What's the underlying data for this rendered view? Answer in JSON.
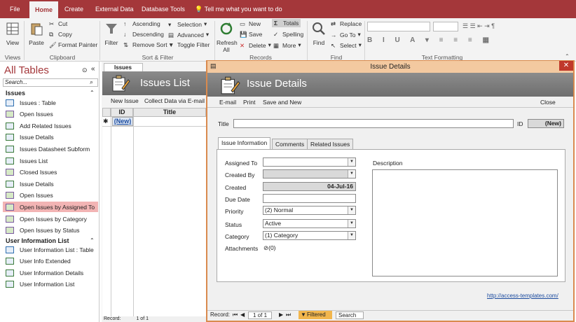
{
  "ribbon_tabs": [
    "File",
    "Home",
    "Create",
    "External Data",
    "Database Tools"
  ],
  "tell_me": "Tell me what you want to do",
  "groups": {
    "views": {
      "label": "Views",
      "view": "View"
    },
    "clipboard": {
      "label": "Clipboard",
      "paste": "Paste",
      "cut": "Cut",
      "copy": "Copy",
      "format_painter": "Format Painter"
    },
    "sort_filter": {
      "label": "Sort & Filter",
      "filter": "Filter",
      "ascending": "Ascending",
      "descending": "Descending",
      "remove_sort": "Remove Sort",
      "selection": "Selection",
      "advanced": "Advanced",
      "toggle_filter": "Toggle Filter"
    },
    "records": {
      "label": "Records",
      "refresh": "Refresh",
      "all": "All",
      "new": "New",
      "save": "Save",
      "delete": "Delete",
      "totals": "Totals",
      "spelling": "Spelling",
      "more": "More"
    },
    "find": {
      "label": "Find",
      "find": "Find",
      "replace": "Replace",
      "go_to": "Go To",
      "select": "Select"
    },
    "text_formatting": {
      "label": "Text Formatting"
    }
  },
  "nav": {
    "title": "All Tables",
    "search_placeholder": "Search...",
    "groups": [
      {
        "name": "Issues",
        "items": [
          "Issues : Table",
          "Open Issues",
          "Add Related Issues",
          "Issue Details",
          "Issues Datasheet Subform",
          "Issues List",
          "Closed Issues",
          "Issue Details",
          "Open Issues",
          "Open Issues by Assigned To",
          "Open Issues by Category",
          "Open Issues by Status"
        ]
      },
      {
        "name": "User Information List",
        "items": [
          "User Information List : Table",
          "User Info Extended",
          "User Information Details",
          "User Information List"
        ]
      }
    ]
  },
  "issues_list": {
    "tab": "Issues List",
    "title": "Issues List",
    "new_issue": "New Issue",
    "collect": "Collect Data via E-mail",
    "col_id": "ID",
    "col_title": "Title",
    "new_row": "(New)",
    "record_label": "Record:",
    "record_pos": "1 of 1"
  },
  "dialog": {
    "caption": "Issue Details",
    "close_x": "✕",
    "title": "Issue Details",
    "links": {
      "email": "E-mail",
      "print": "Print",
      "save_new": "Save and New",
      "close": "Close"
    },
    "title_label": "Title",
    "id_label": "ID",
    "id_value": "(New)",
    "tabs": [
      "Issue Information",
      "Comments",
      "Related Issues"
    ],
    "fields": {
      "assigned_to": {
        "label": "Assigned To",
        "value": ""
      },
      "created_by": {
        "label": "Created By",
        "value": ""
      },
      "created": {
        "label": "Created",
        "value": "04-Jul-16"
      },
      "due_date": {
        "label": "Due Date",
        "value": ""
      },
      "priority": {
        "label": "Priority",
        "value": "(2) Normal"
      },
      "status": {
        "label": "Status",
        "value": "Active"
      },
      "category": {
        "label": "Category",
        "value": "(1) Category"
      },
      "attachments": {
        "label": "Attachments",
        "value": "(0)"
      }
    },
    "description_label": "Description",
    "footer_link": "http://access-templates.com/",
    "record_label": "Record:",
    "record_pos": "1 of 1",
    "filtered": "Filtered",
    "search": "Search"
  },
  "colors": {
    "accent": "#a4373a",
    "dialog_border": "#d98a4e",
    "highlight": "#f2b4b4"
  }
}
